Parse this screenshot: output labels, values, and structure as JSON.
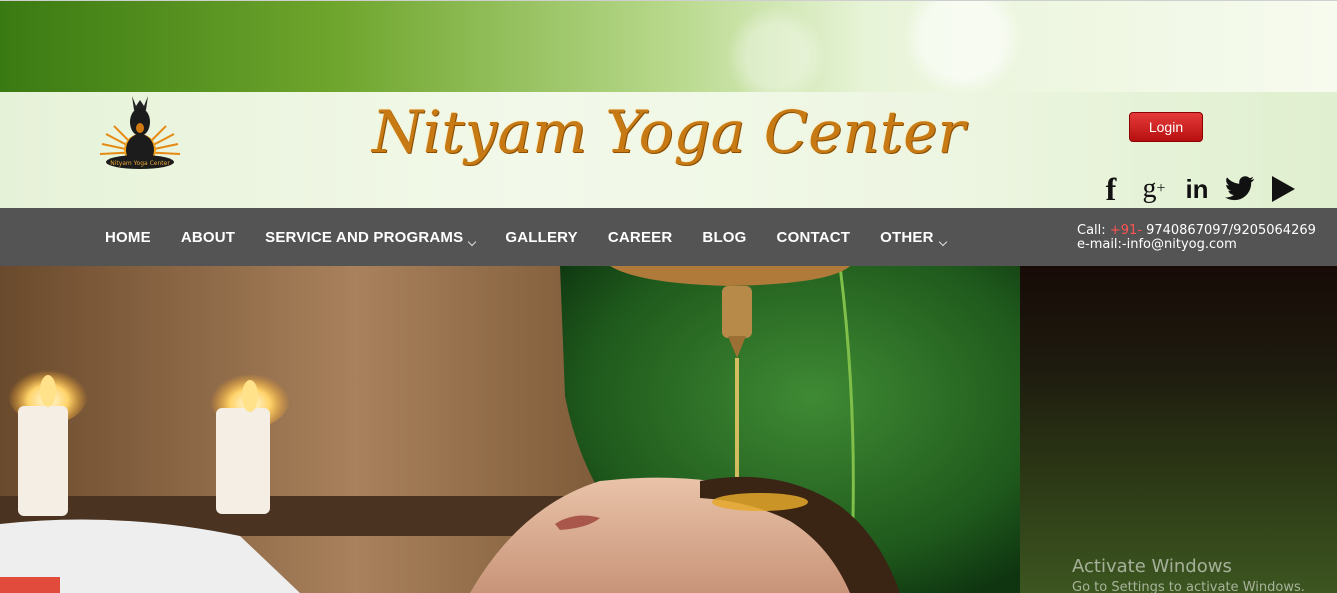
{
  "header": {
    "site_title": "Nityam Yoga Center",
    "logo_text": "Nityam Yoga Center",
    "login_label": "Login",
    "social": [
      {
        "icon": "facebook-icon",
        "glyph": "f"
      },
      {
        "icon": "google-plus-icon",
        "glyph": "g"
      },
      {
        "icon": "linkedin-icon",
        "glyph": "in"
      },
      {
        "icon": "twitter-icon",
        "glyph": ""
      },
      {
        "icon": "youtube-play-icon",
        "glyph": ""
      }
    ]
  },
  "nav": {
    "items": [
      {
        "label": "HOME",
        "dropdown": false
      },
      {
        "label": "ABOUT",
        "dropdown": false
      },
      {
        "label": "SERVICE AND PROGRAMS",
        "dropdown": true
      },
      {
        "label": "GALLERY",
        "dropdown": false
      },
      {
        "label": "CAREER",
        "dropdown": false
      },
      {
        "label": "BLOG",
        "dropdown": false
      },
      {
        "label": "CONTACT",
        "dropdown": false
      },
      {
        "label": "OTHER",
        "dropdown": true
      }
    ]
  },
  "contact": {
    "call_label": "Call:",
    "country_code": "+91-",
    "phones": "9740867097/9205064269",
    "email_line": "e-mail:-info@nityog.com"
  },
  "watermark": {
    "line1": "Activate Windows",
    "line2": "Go to Settings to activate Windows."
  },
  "colors": {
    "title": "#c77a14",
    "nav_bg": "#545454",
    "login": "#c91a1a",
    "country_code": "#ff5252"
  }
}
